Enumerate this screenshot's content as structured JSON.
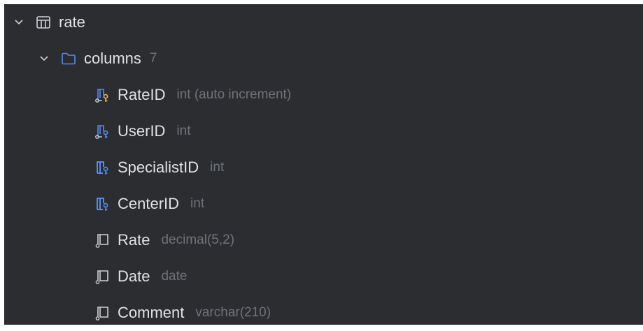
{
  "tree": {
    "table": {
      "name": "rate",
      "expanded": true,
      "icon": "table-icon"
    },
    "group": {
      "name": "columns",
      "count": "7",
      "expanded": true,
      "icon": "folder-icon"
    },
    "columns": [
      {
        "name": "RateID",
        "type": "int (auto increment)",
        "icon": "primary-key-column-icon",
        "accent": "#548af7"
      },
      {
        "name": "UserID",
        "type": "int",
        "icon": "primary-key-column-icon",
        "accent": "#548af7"
      },
      {
        "name": "SpecialistID",
        "type": "int",
        "icon": "foreign-key-column-icon",
        "accent": "#548af7"
      },
      {
        "name": "CenterID",
        "type": "int",
        "icon": "foreign-key-column-icon",
        "accent": "#548af7"
      },
      {
        "name": "Rate",
        "type": "decimal(5,2)",
        "icon": "column-icon",
        "accent": "#ced0d6"
      },
      {
        "name": "Date",
        "type": "date",
        "icon": "column-icon",
        "accent": "#ced0d6"
      },
      {
        "name": "Comment",
        "type": "varchar(210)",
        "icon": "column-icon",
        "accent": "#ced0d6"
      }
    ]
  }
}
